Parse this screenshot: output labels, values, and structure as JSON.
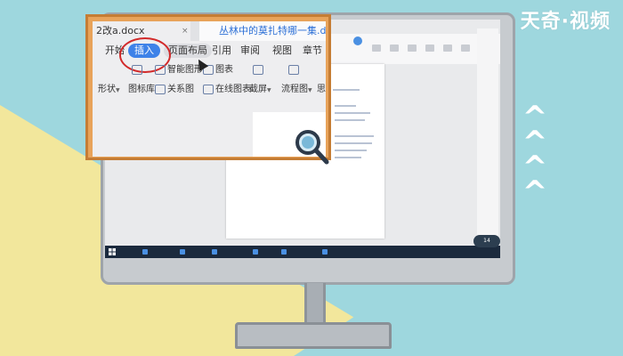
{
  "watermark": "天奇·视频",
  "colors": {
    "background": "#9ed7de",
    "accent_yellow": "#f2e79c",
    "frame_wood": "#e8a35a",
    "tab_active": "#3e82e8",
    "highlight_ring": "#d22a2a"
  },
  "decor": {
    "chevrons": "^ ^ ^ ^"
  },
  "ribbon": {
    "tabs": [
      {
        "title": "2改a.docx",
        "close": "×"
      },
      {
        "title": "丛林中的莫扎特哪一集.docx",
        "icon": "W"
      }
    ],
    "menu": [
      "开始",
      "插入",
      "页面布局",
      "引用",
      "审阅",
      "视图",
      "章节"
    ],
    "active_menu": "插入",
    "tools_row1": [
      "智能图形",
      "图表"
    ],
    "tools_row2": [
      "形状",
      "图标库",
      "关系图",
      "在线图表",
      "截屏",
      "流程图",
      "思"
    ]
  },
  "desktop": {
    "badge": "14"
  }
}
